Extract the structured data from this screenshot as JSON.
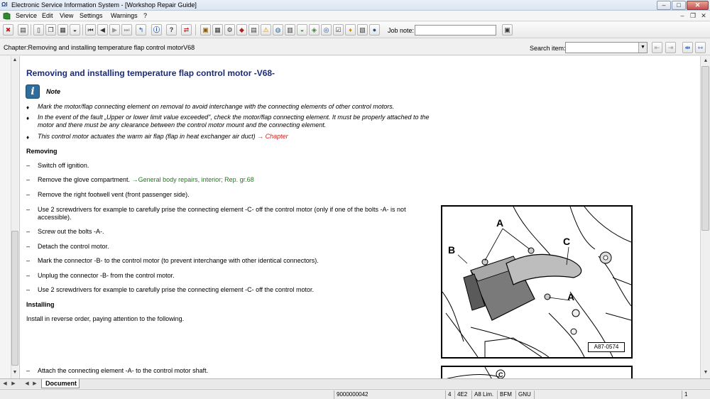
{
  "window": {
    "title": "Electronic Service Information System - [Workshop Repair Guide]",
    "app_icon_text": "ΩI",
    "minimize": "–",
    "maximize": "□",
    "close": "✕"
  },
  "menu": {
    "items": [
      "Service",
      "Edit",
      "View",
      "Settings",
      "Warnings",
      "?"
    ],
    "mdi_minimize": "–",
    "mdi_restore": "❐",
    "mdi_close": "✕"
  },
  "toolbar": {
    "job_note_label": "Job note:",
    "job_note_value": "",
    "icons": [
      "exit-icon",
      "print-icon",
      "new-document-icon",
      "copy-icon",
      "clipboard-icon",
      "car-icon",
      "first-page-icon",
      "previous-page-icon",
      "next-page-icon",
      "last-page-icon",
      "jump-back-icon",
      "info-icon",
      "help-icon",
      "exchange-icon",
      "book-icon",
      "table-icon",
      "tools-icon",
      "diagnosis-icon",
      "manual-icon",
      "warning-icon",
      "globe-icon",
      "bin-icon",
      "green-car-icon",
      "component-icon",
      "wiring-icon",
      "checklist-icon",
      "lightbulb-icon",
      "earth-icon"
    ]
  },
  "chapter": {
    "text": "Chapter:Removing and installing temperature flap control motorV68",
    "search_label": "Search item:",
    "search_value": ""
  },
  "document": {
    "title": "Removing and installing temperature flap control motor -V68-",
    "note_label": "Note",
    "notes": [
      {
        "text": "Mark the motor/flap connecting element on removal to avoid interchange with the connecting elements of other control motors.",
        "link": ""
      },
      {
        "text": "In the event of the fault „Upper or lower limit value exceeded\", check the motor/flap connecting element. It must be properly attached to the motor and there must be any clearance between the control motor mount and the connecting element.",
        "link": ""
      },
      {
        "text": "This control motor actuates the warm air flap (flap in heat exchanger air duct) ",
        "link": "→ Chapter"
      }
    ],
    "removing_heading": "Removing",
    "removing_steps": [
      {
        "text": "Switch off ignition.",
        "link": ""
      },
      {
        "text": "Remove the glove compartment. ",
        "link": "→General body repairs, interior; Rep. gr.68"
      },
      {
        "text": "Remove the right footwell vent (front passenger side).",
        "link": ""
      },
      {
        "text": "Use 2 screwdrivers for example to carefully prise the connecting element -C- off the control motor (only if one of the bolts -A- is not accessible).",
        "link": ""
      },
      {
        "text": "Screw out the bolts -A-.",
        "link": ""
      },
      {
        "text": "Detach the control motor.",
        "link": ""
      },
      {
        "text": "Mark the connector -B- to the control motor (to prevent interchange with other identical connectors).",
        "link": ""
      },
      {
        "text": "Unplug the connector -B- from the control motor.",
        "link": ""
      },
      {
        "text": "Use 2 screwdrivers for example to carefully prise the connecting element -C- off the control motor.",
        "link": ""
      }
    ],
    "installing_heading": "Installing",
    "installing_intro": "Install in reverse order, paying attention to the following.",
    "installing_steps": [
      {
        "text": "Attach the connecting element -A- to the control motor shaft.",
        "link": ""
      }
    ],
    "dash": "–",
    "bullet": "♦",
    "figure": {
      "label_a_top": "A",
      "label_b": "B",
      "label_c": "C",
      "label_a_right": "A",
      "tag": "A87-0574",
      "next_label_c": "C"
    }
  },
  "tabs": {
    "active": "Document"
  },
  "status": {
    "doc_number": "9000000042",
    "cell_1": "4",
    "cell_2": "4E2",
    "cell_3": "A8 Lim.",
    "cell_4": "BFM",
    "cell_5": "GNU",
    "page": "1"
  },
  "colors": {
    "title": "#1a2a7a",
    "link_red": "#cc2222",
    "link_green": "#1d7a1d"
  }
}
